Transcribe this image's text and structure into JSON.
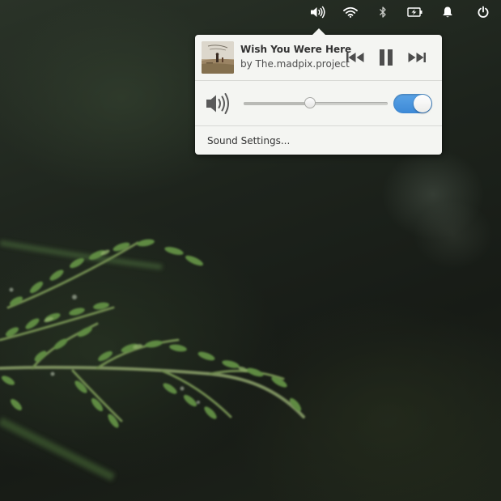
{
  "panel": {
    "indicators": [
      {
        "name": "sound",
        "icon": "volume-high-icon"
      },
      {
        "name": "network",
        "icon": "wifi-icon"
      },
      {
        "name": "bluetooth",
        "icon": "bluetooth-icon"
      },
      {
        "name": "power",
        "icon": "battery-charging-icon"
      },
      {
        "name": "notifications",
        "icon": "bell-icon"
      },
      {
        "name": "session",
        "icon": "power-icon"
      }
    ]
  },
  "sound_popover": {
    "player": {
      "track_title": "Wish You Were Here",
      "artist_line": "by The.madpix.project",
      "state": "playing"
    },
    "volume": {
      "level": 0.46,
      "output_enabled": true
    },
    "settings_label": "Sound Settings..."
  },
  "colors": {
    "accent": "#3d89d6",
    "popover_bg": "#f4f5f2",
    "panel_icon": "#ffffff"
  }
}
